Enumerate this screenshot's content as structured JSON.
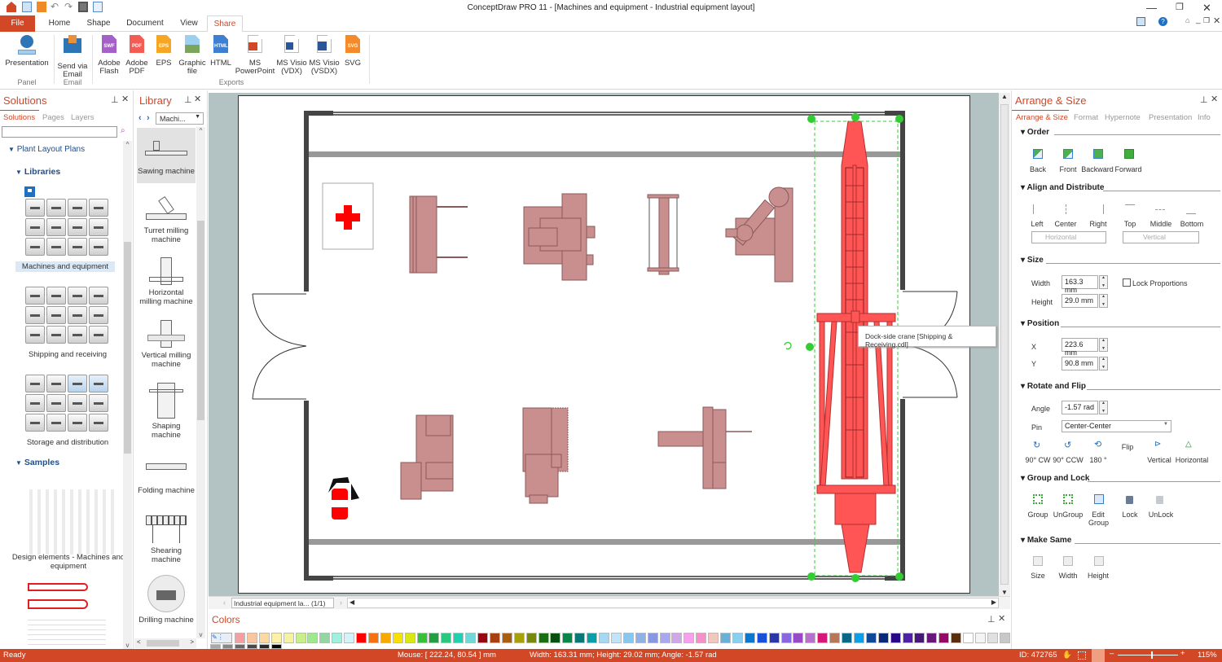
{
  "app": {
    "title": "ConceptDraw PRO 11 - [Machines and equipment - Industrial equipment layout]",
    "quick_access": [
      "app-logo-icon",
      "new-icon",
      "open-icon",
      "undo-icon",
      "redo-icon",
      "save-icon",
      "print-preview-icon"
    ],
    "window_controls": [
      "minimize-icon",
      "restore-icon",
      "close-icon"
    ]
  },
  "ribbon_tabs": [
    {
      "label": "File",
      "active": false
    },
    {
      "label": "Home",
      "active": false
    },
    {
      "label": "Shape",
      "active": false
    },
    {
      "label": "Document",
      "active": false
    },
    {
      "label": "View",
      "active": false
    },
    {
      "label": "Share",
      "active": true
    }
  ],
  "ribbon": {
    "buttons": [
      {
        "label": "Presentation",
        "sub": "",
        "icon": "presentation-icon",
        "color": "#2e75b6"
      },
      {
        "label": "Send via",
        "sub": "Email",
        "icon": "email-icon",
        "color": "#e8913a"
      },
      {
        "label": "Adobe",
        "sub": "Flash",
        "icon": "SWF",
        "color": "#a560c8"
      },
      {
        "label": "Adobe",
        "sub": "PDF",
        "icon": "PDF",
        "color": "#f25c54"
      },
      {
        "label": "EPS",
        "sub": "",
        "icon": "EPS",
        "color": "#f6a623"
      },
      {
        "label": "Graphic",
        "sub": "file",
        "icon": "image-icon",
        "color": "#7bb7d8"
      },
      {
        "label": "HTML",
        "sub": "",
        "icon": "HTML",
        "color": "#3f7fd1"
      },
      {
        "label": "MS",
        "sub": "PowerPoint",
        "icon": "powerpoint-icon",
        "color": "#d24726"
      },
      {
        "label": "MS Visio",
        "sub": "(VDX)",
        "icon": "visio-icon",
        "color": "#2b579a"
      },
      {
        "label": "MS Visio",
        "sub": "(VSDX)",
        "icon": "visio-icon",
        "color": "#2b579a"
      },
      {
        "label": "SVG",
        "sub": "",
        "icon": "SVG",
        "color": "#f58a2a"
      }
    ],
    "groups": [
      "Panel",
      "Email",
      "Exports"
    ]
  },
  "solutions_panel": {
    "title": "Solutions",
    "tabs": [
      "Solutions",
      "Pages",
      "Layers"
    ],
    "search_placeholder": "",
    "tree": {
      "root": "Plant Layout Plans",
      "libraries_label": "Libraries",
      "libraries": [
        "Machines and equipment",
        "Shipping and receiving",
        "Storage and distribution"
      ],
      "samples_label": "Samples",
      "samples": [
        "Design elements - Machines and equipment"
      ]
    }
  },
  "library_panel": {
    "title": "Library",
    "dropdown": "Machi...",
    "items": [
      "Sawing machine",
      "Turret milling machine",
      "Horizontal milling machine",
      "Vertical milling machine",
      "Shaping machine",
      "Folding machine",
      "Shearing machine",
      "Drilling machine"
    ]
  },
  "canvas": {
    "tooltip": "Dock-side crane [Shipping & Receiving.cdl]",
    "page_selector": "Industrial equipment la... (1/1)",
    "selected_shape": "Dock-side crane"
  },
  "colors_panel": {
    "title": "Colors",
    "swatches": [
      "#f4a0a0",
      "#f8c6a0",
      "#fcd9a0",
      "#fdf0a8",
      "#f6f3a0",
      "#c8f08a",
      "#a0e890",
      "#90d8a0",
      "#a0f0e0",
      "#d0f4f8",
      "#ff0000",
      "#f87010",
      "#f8a800",
      "#f8e000",
      "#d8e810",
      "#38c038",
      "#20a040",
      "#28c880",
      "#20d0b0",
      "#70d8d8",
      "#980810",
      "#a84010",
      "#a86010",
      "#a8a008",
      "#788808",
      "#187010",
      "#085010",
      "#088848",
      "#087878",
      "#08a0a8",
      "#a8d8f0",
      "#c0e4f8",
      "#88c8f0",
      "#90b0e8",
      "#8898e0",
      "#a8a8f0",
      "#d0a8e8",
      "#f8a0f0",
      "#f890c8",
      "#f0c8c0",
      "#68b0d8",
      "#88d0f0",
      "#0878d0",
      "#1850d8",
      "#2838a8",
      "#8868e0",
      "#9848c8",
      "#b870d0",
      "#d81878",
      "#b87858",
      "#086888",
      "#08a0e8",
      "#104898",
      "#082878",
      "#280888",
      "#5020a8",
      "#481878",
      "#681878",
      "#980868",
      "#583010",
      "#ffffff",
      "#f4f4f4",
      "#e0e0e0",
      "#c8c8c8",
      "#a8a8a8",
      "#888888",
      "#686868",
      "#484848",
      "#282828",
      "#080808"
    ]
  },
  "arrange_panel": {
    "title": "Arrange & Size",
    "tabs": [
      "Arrange & Size",
      "Format",
      "Hypernote",
      "Presentation",
      "Info"
    ],
    "order": {
      "label": "Order",
      "buttons": [
        "Back",
        "Front",
        "Backward",
        "Forward"
      ]
    },
    "align": {
      "label": "Align and Distribute",
      "buttons": [
        "Left",
        "Center",
        "Right",
        "Top",
        "Middle",
        "Bottom"
      ],
      "horizontal": "Horizontal",
      "vertical": "Vertical"
    },
    "size": {
      "label": "Size",
      "width_label": "Width",
      "width": "163.3 mm",
      "height_label": "Height",
      "height": "29.0 mm",
      "lock_label": "Lock Proportions",
      "lock_checked": false
    },
    "position": {
      "label": "Position",
      "x_label": "X",
      "x": "223.6 mm",
      "y_label": "Y",
      "y": "90.8 mm"
    },
    "rotate": {
      "label": "Rotate and Flip",
      "angle_label": "Angle",
      "angle": "-1.57 rad",
      "pin_label": "Pin",
      "pin": "Center-Center",
      "buttons": [
        "90° CW",
        "90° CCW",
        "180 °",
        "Flip",
        "Vertical",
        "Horizontal"
      ]
    },
    "group": {
      "label": "Group and Lock",
      "buttons": [
        "Group",
        "UnGroup",
        "Edit Group",
        "Lock",
        "UnLock"
      ]
    },
    "make_same": {
      "label": "Make Same",
      "buttons": [
        "Size",
        "Width",
        "Height"
      ]
    }
  },
  "status": {
    "ready": "Ready",
    "mouse": "Mouse: [ 222.24, 80.54 ] mm",
    "dims": "Width: 163.31 mm;  Height: 29.02 mm;  Angle: -1.57 rad",
    "id": "ID: 472765",
    "zoom": "115%",
    "zoom_fraction": 0.55
  }
}
